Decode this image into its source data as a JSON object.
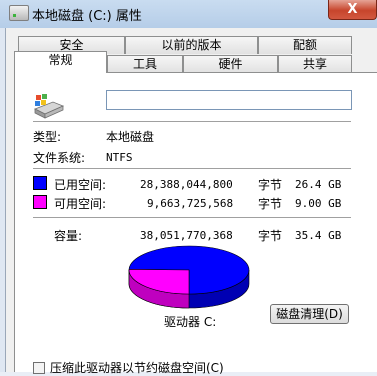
{
  "window": {
    "title": "本地磁盘 (C:) 属性",
    "close_label": "X"
  },
  "tabs_row1": [
    {
      "label": "安全"
    },
    {
      "label": "以前的版本"
    },
    {
      "label": "配额"
    }
  ],
  "tabs_row2": [
    {
      "label": "常规",
      "active": true
    },
    {
      "label": "工具"
    },
    {
      "label": "硬件"
    },
    {
      "label": "共享"
    }
  ],
  "general": {
    "volume_name_value": "",
    "type_label": "类型:",
    "type_value": "本地磁盘",
    "fs_label": "文件系统:",
    "fs_value": "NTFS",
    "used": {
      "label": "已用空间:",
      "bytes": "28,388,044,800",
      "unit": "字节",
      "size": "26.4 GB",
      "color": "#0000ff"
    },
    "free": {
      "label": "可用空间:",
      "bytes": "9,663,725,568",
      "unit": "字节",
      "size": "9.00 GB",
      "color": "#ff00ff"
    },
    "capacity": {
      "label": "容量:",
      "bytes": "38,051,770,368",
      "unit": "字节",
      "size": "35.4 GB"
    },
    "drive_label": "驱动器 C:",
    "cleanup_button": "磁盘清理(D)",
    "compress_label": "压缩此驱动器以节约磁盘空间(C)"
  },
  "chart_data": {
    "type": "pie",
    "categories": [
      "已用空间",
      "可用空间"
    ],
    "values": [
      26.4,
      9.0
    ],
    "colors": [
      "#0000ff",
      "#ff00ff"
    ]
  }
}
